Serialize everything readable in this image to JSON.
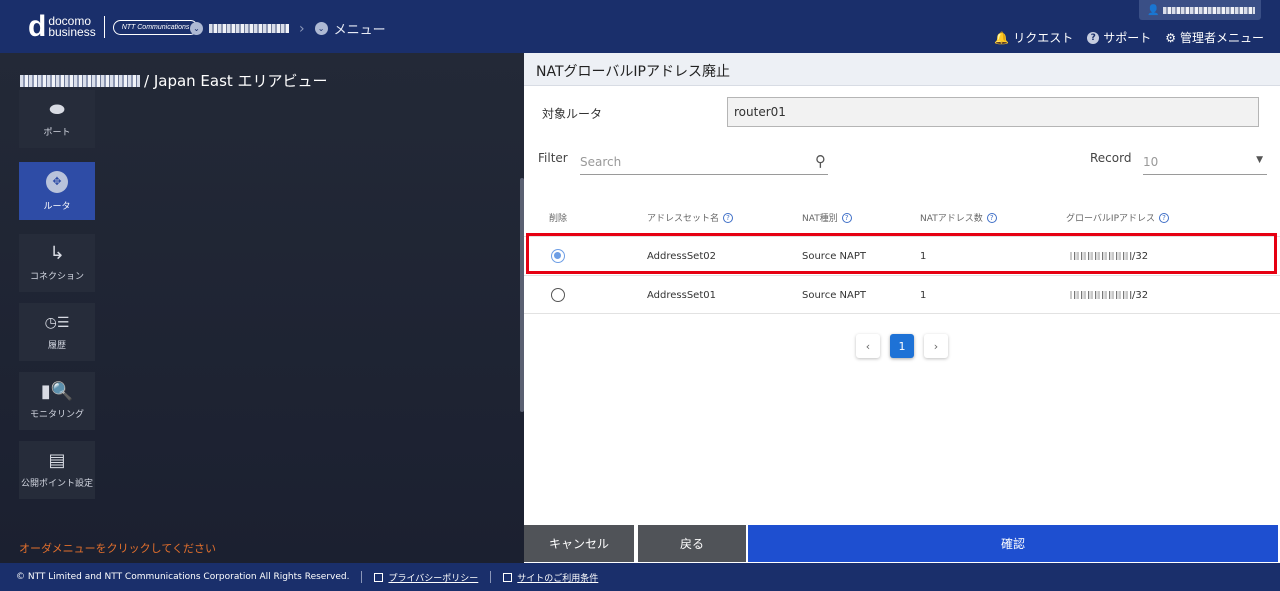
{
  "header": {
    "logo_d": "d",
    "logo_line1": "docomo",
    "logo_line2": "business",
    "logo_ntt": "NTT Communications",
    "breadcrumb_menu": "メニュー",
    "nav": {
      "request": "リクエスト",
      "support": "サポート",
      "admin_menu": "管理者メニュー"
    }
  },
  "area": {
    "title_suffix": "/ Japan East エリアビュー"
  },
  "sidebar": {
    "items": [
      {
        "label": "ポート",
        "icon": "port-icon"
      },
      {
        "label": "ルータ",
        "icon": "router-icon",
        "active": true
      },
      {
        "label": "コネクション",
        "icon": "connection-icon"
      },
      {
        "label": "履歴",
        "icon": "history-icon"
      },
      {
        "label": "モニタリング",
        "icon": "monitoring-icon"
      },
      {
        "label": "公開ポイント設定",
        "icon": "public-point-icon"
      }
    ],
    "order_hint": "オーダメニューをクリックしてください"
  },
  "panel": {
    "title": "NATグローバルIPアドレス廃止",
    "router_label": "対象ルータ",
    "router_value": "router01",
    "filter_label": "Filter",
    "search_placeholder": "Search",
    "record_label": "Record",
    "record_value": "10",
    "columns": [
      "削除",
      "アドレスセット名",
      "NAT種別",
      "NATアドレス数",
      "グローバルIPアドレス"
    ],
    "rows": [
      {
        "selected": true,
        "address_set": "AddressSet02",
        "nat_type": "Source NAPT",
        "count": "1",
        "ip_suffix": "/32"
      },
      {
        "selected": false,
        "address_set": "AddressSet01",
        "nat_type": "Source NAPT",
        "count": "1",
        "ip_suffix": "/32"
      }
    ],
    "pagination": {
      "prev": "‹",
      "current": "1",
      "next": "›"
    }
  },
  "actions": {
    "cancel": "キャンセル",
    "back": "戻る",
    "confirm": "確認"
  },
  "footer": {
    "copyright": "© NTT Limited and NTT Communications Corporation All Rights Reserved.",
    "privacy": "プライバシーポリシー",
    "terms": "サイトのご利用条件"
  },
  "colors": {
    "header_bg": "#1a2f6b",
    "active_side": "#2e4ca6",
    "confirm_bg": "#1e4fd0",
    "highlight": "#e60012",
    "hint_text": "#e36f2c"
  }
}
